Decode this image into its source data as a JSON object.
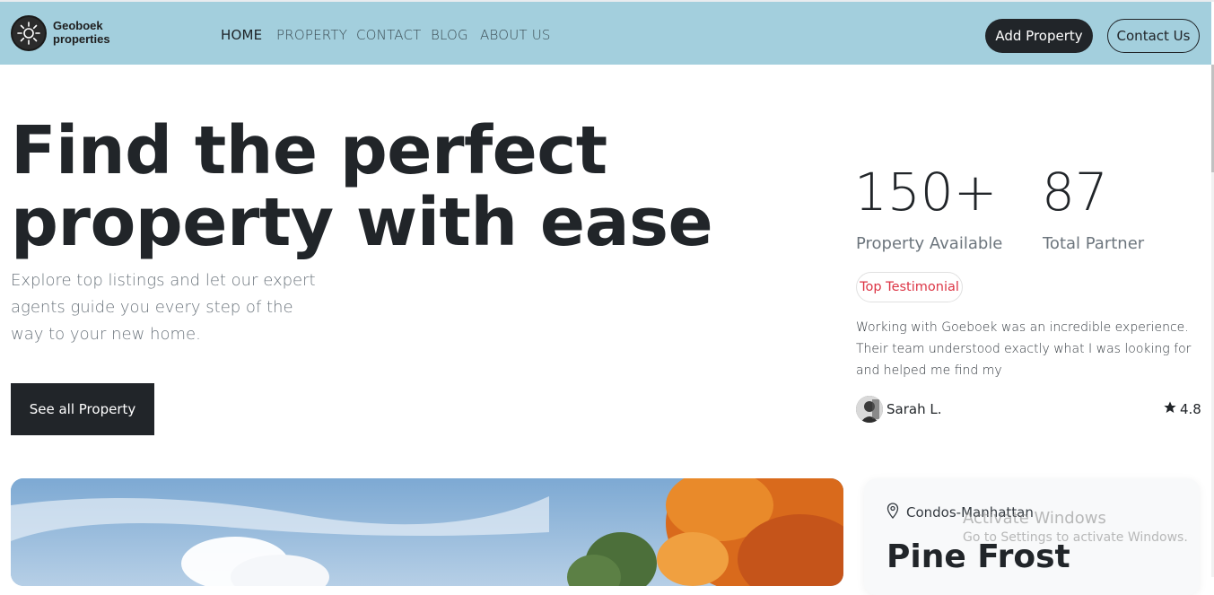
{
  "brand": {
    "line1": "Geoboek",
    "line2": "properties"
  },
  "nav": {
    "links": [
      {
        "label": "HOME"
      },
      {
        "label": "PROPERTY"
      },
      {
        "label": "CONTACT"
      },
      {
        "label": "BLOG"
      },
      {
        "label": "ABOUT US"
      }
    ],
    "add_property": "Add Property",
    "contact_us": "Contact Us"
  },
  "hero": {
    "title_line1": "Find the perfect",
    "title_line2": "property with ease",
    "subtitle": "Explore top listings and let our expert agents guide you every step of the way to your new home.",
    "cta": "See all Property"
  },
  "stats": [
    {
      "value": "150+",
      "label": "Property Available"
    },
    {
      "value": "87",
      "label": "Total Partner"
    }
  ],
  "testimonial": {
    "badge": "Top Testimonial",
    "text": "Working with Goeboek was an incredible experience. Their team understood exactly what I was looking for and helped me find my",
    "author": "Sarah L.",
    "rating": "4.8"
  },
  "featured": {
    "location": "Condos-Manhattan",
    "name": "Pine Frost"
  },
  "watermark": {
    "title": "Activate Windows",
    "subtitle": "Go to Settings to activate Windows."
  },
  "colors": {
    "navbar_bg": "#a3cfdd",
    "dark": "#212529",
    "badge_text": "#dc3545"
  },
  "icons": [
    "sun-logo-icon",
    "location-pin-icon",
    "star-icon"
  ]
}
